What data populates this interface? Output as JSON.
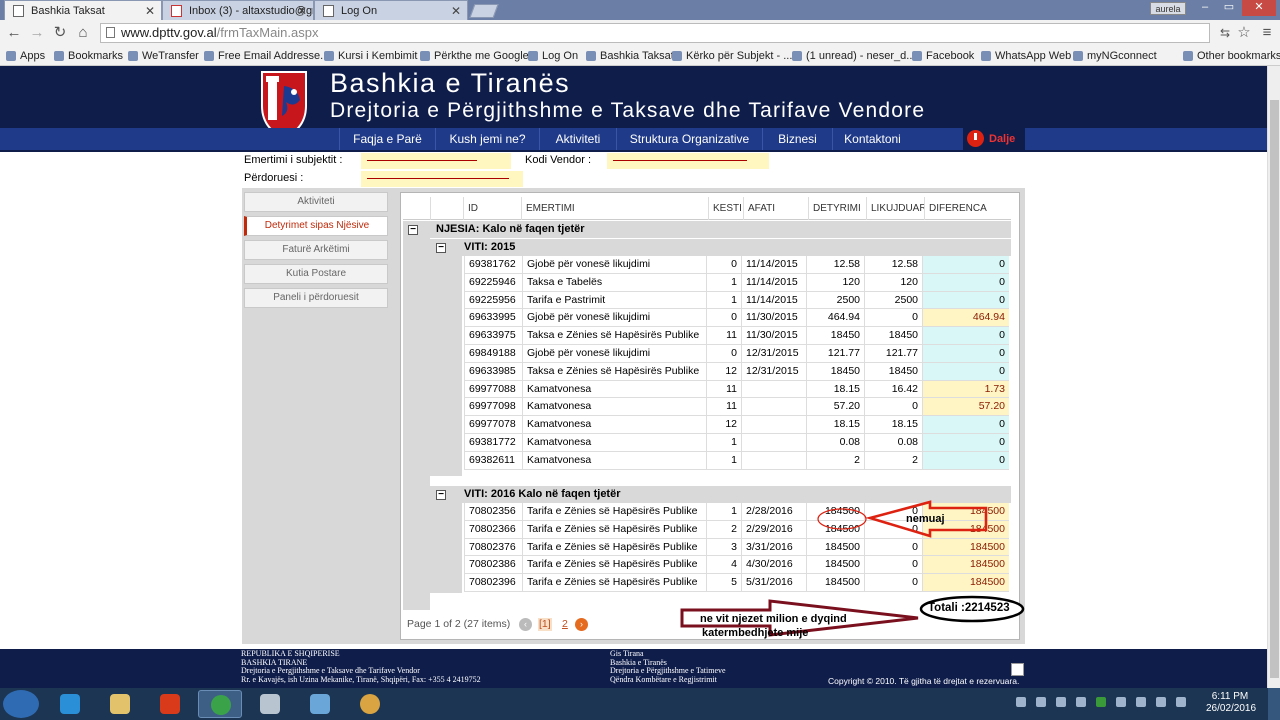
{
  "browser": {
    "tabs": [
      {
        "title": "Bashkia Taksat"
      },
      {
        "title": "Inbox (3) - altaxstudio@gm"
      },
      {
        "title": "Log On"
      }
    ],
    "user_badge": "aurela",
    "address_domain": "www.dpttv.gov.al",
    "address_path": "/frmTaxMain.aspx",
    "bookmarks": [
      "Apps",
      "Bookmarks",
      "WeTransfer",
      "Free Email Addresse...",
      "Kursi i Kembimit",
      "Përkthe me Google",
      "Log On",
      "Bashkia Taksat",
      "Kërko për Subjekt - ...",
      "(1 unread) - neser_d...",
      "Facebook",
      "WhatsApp Web",
      "myNGconnect",
      "Other bookmarks"
    ]
  },
  "header": {
    "title": "Bashkia e Tiranës",
    "subtitle": "Drejtoria e Përgjithshme e Taksave dhe Tarifave Vendore"
  },
  "nav": [
    "Faqja e Parë",
    "Kush jemi ne?",
    "Aktiviteti",
    "Struktura Organizative",
    "Biznesi",
    "Kontaktoni"
  ],
  "logout": "Dalje",
  "info": {
    "subject_label": "Emertimi i subjektit :",
    "vendor_label": "Kodi Vendor :",
    "user_label": "Përdoruesi :"
  },
  "sidebar": [
    {
      "label": "Aktiviteti",
      "active": false
    },
    {
      "label": "Detyrimet sipas Njësive",
      "active": true
    },
    {
      "label": "Faturë Arkëtimi",
      "active": false
    },
    {
      "label": "Kutia Postare",
      "active": false
    },
    {
      "label": "Paneli i përdoruesit",
      "active": false
    }
  ],
  "grid": {
    "columns": [
      "ID",
      "EMERTIMI",
      "KESTI",
      "AFATI",
      "DETYRIMI",
      "LIKUJDUAR",
      "DIFERENCA"
    ],
    "unit_group": "NJESIA: Kalo në faqen tjetër",
    "year_groups": [
      {
        "label": "VITI: 2015",
        "rows": [
          [
            "69381762",
            "Gjobë për vonesë likujdimi",
            "0",
            "11/14/2015",
            "12.58",
            "12.58",
            "0"
          ],
          [
            "69225946",
            "Taksa e Tabelës",
            "1",
            "11/14/2015",
            "120",
            "120",
            "0"
          ],
          [
            "69225956",
            "Tarifa e Pastrimit",
            "1",
            "11/14/2015",
            "2500",
            "2500",
            "0"
          ],
          [
            "69633995",
            "Gjobë për vonesë likujdimi",
            "0",
            "11/30/2015",
            "464.94",
            "0",
            "464.94"
          ],
          [
            "69633975",
            "Taksa e Zënies së Hapësirës Publike",
            "11",
            "11/30/2015",
            "18450",
            "18450",
            "0"
          ],
          [
            "69849188",
            "Gjobë për vonesë likujdimi",
            "0",
            "12/31/2015",
            "121.77",
            "121.77",
            "0"
          ],
          [
            "69633985",
            "Taksa e Zënies së Hapësirës Publike",
            "12",
            "12/31/2015",
            "18450",
            "18450",
            "0"
          ],
          [
            "69977088",
            "Kamatvonesa",
            "11",
            "",
            "18.15",
            "16.42",
            "1.73"
          ],
          [
            "69977098",
            "Kamatvonesa",
            "11",
            "",
            "57.20",
            "0",
            "57.20"
          ],
          [
            "69977078",
            "Kamatvonesa",
            "12",
            "",
            "18.15",
            "18.15",
            "0"
          ],
          [
            "69381772",
            "Kamatvonesa",
            "1",
            "",
            "0.08",
            "0.08",
            "0"
          ],
          [
            "69382611",
            "Kamatvonesa",
            "1",
            "",
            "2",
            "2",
            "0"
          ]
        ]
      },
      {
        "label": "VITI: 2016 Kalo në faqen tjetër",
        "rows": [
          [
            "70802356",
            "Tarifa e Zënies së Hapësirës Publike",
            "1",
            "2/28/2016",
            "184500",
            "0",
            "184500"
          ],
          [
            "70802366",
            "Tarifa e Zënies së Hapësirës Publike",
            "2",
            "2/29/2016",
            "184500",
            "0",
            "184500"
          ],
          [
            "70802376",
            "Tarifa e Zënies së Hapësirës Publike",
            "3",
            "3/31/2016",
            "184500",
            "0",
            "184500"
          ],
          [
            "70802386",
            "Tarifa e Zënies së Hapësirës Publike",
            "4",
            "4/30/2016",
            "184500",
            "0",
            "184500"
          ],
          [
            "70802396",
            "Tarifa e Zënies së Hapësirës Publike",
            "5",
            "5/31/2016",
            "184500",
            "0",
            "184500"
          ]
        ]
      }
    ],
    "total": "Totali :2214523",
    "pager_text": "Page 1 of 2 (27 items)",
    "pages": [
      "[1]",
      "2"
    ]
  },
  "annotations": {
    "monthly": "nemuaj",
    "yearly_line1": "ne vit njezet milion e dyqind",
    "yearly_line2": "katermbedhjete mije"
  },
  "footer": {
    "left": [
      "REPUBLIKA E SHQIPERISE",
      "BASHKIA TIRANE",
      "Drejtoria e Pergjithshme e Taksave dhe Tarifave Vendor",
      "Rr. e Kavajës, ish Uzina Mekanike, Tiranë, Shqipëri, Fax: +355 4 2419752"
    ],
    "mid": [
      "Gis Tirana",
      "Bashkia e Tiranës",
      "Drejtoria e Përgjithshme e Tatimeve",
      "Qëndra Kombëtare e Regjistrimit"
    ],
    "copyright": "Copyright © 2010. Të gjitha të drejtat e rezervuara."
  },
  "taskbar": {
    "time": "6:11 PM",
    "date": "26/02/2016"
  }
}
